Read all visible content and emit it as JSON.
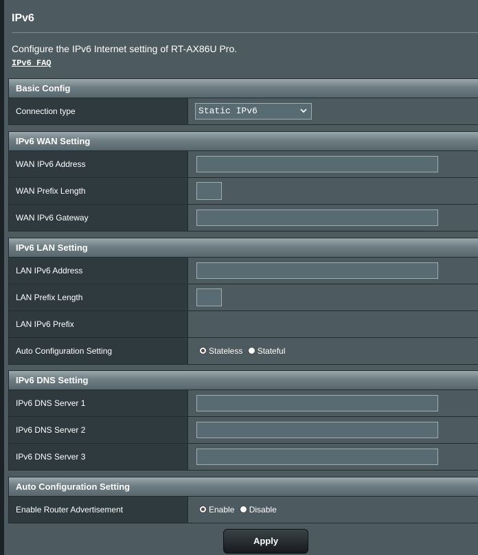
{
  "page": {
    "title": "IPv6",
    "description": "Configure the IPv6 Internet setting of RT-AX86U Pro.",
    "faq_link": "IPv6 FAQ"
  },
  "basic_config": {
    "header": "Basic Config",
    "connection_type_label": "Connection type",
    "connection_type_value": "Static IPv6"
  },
  "wan_setting": {
    "header": "IPv6 WAN Setting",
    "address_label": "WAN IPv6 Address",
    "address_value": "",
    "prefix_length_label": "WAN Prefix Length",
    "prefix_length_value": "",
    "gateway_label": "WAN IPv6 Gateway",
    "gateway_value": ""
  },
  "lan_setting": {
    "header": "IPv6 LAN Setting",
    "address_label": "LAN IPv6 Address",
    "address_value": "",
    "prefix_length_label": "LAN Prefix Length",
    "prefix_length_value": "",
    "prefix_label": "LAN IPv6 Prefix",
    "auto_config_label": "Auto Configuration Setting",
    "auto_config_options": [
      {
        "label": "Stateless",
        "checked": true
      },
      {
        "label": "Stateful",
        "checked": false
      }
    ]
  },
  "dns_setting": {
    "header": "IPv6 DNS Setting",
    "server1_label": "IPv6 DNS Server 1",
    "server1_value": "",
    "server2_label": "IPv6 DNS Server 2",
    "server2_value": "",
    "server3_label": "IPv6 DNS Server 3",
    "server3_value": ""
  },
  "auto_config": {
    "header": "Auto Configuration Setting",
    "router_adv_label": "Enable Router Advertisement",
    "router_adv_options": [
      {
        "label": "Enable",
        "checked": true
      },
      {
        "label": "Disable",
        "checked": false
      }
    ]
  },
  "apply_label": "Apply"
}
